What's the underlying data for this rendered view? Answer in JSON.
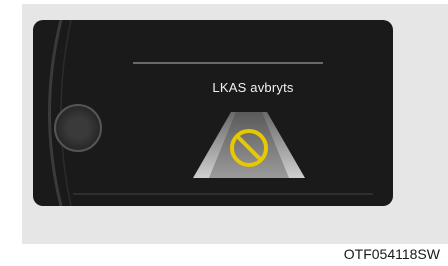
{
  "display": {
    "message": "LKAS avbryts",
    "status_icon": "prohibited-icon",
    "lane_icon": "lane-road-icon",
    "warning_color": "#e8c800"
  },
  "caption": "OTF054118SW"
}
